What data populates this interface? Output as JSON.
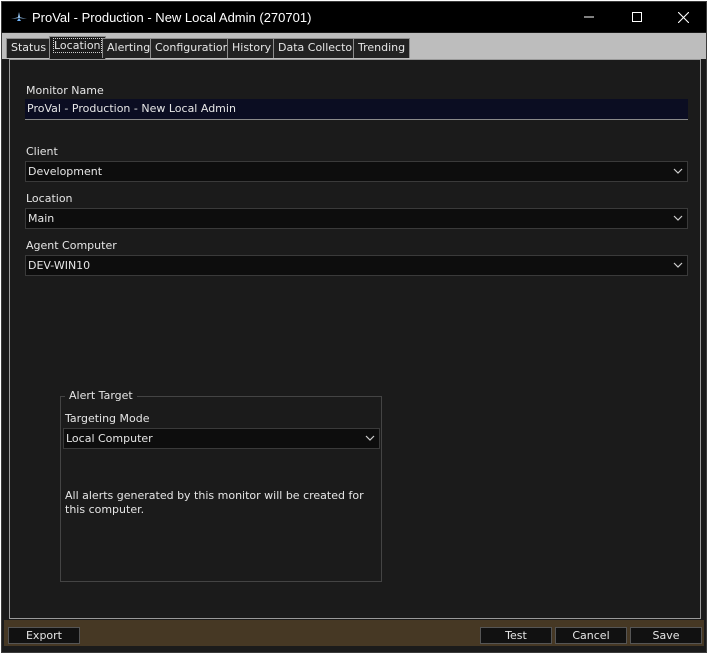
{
  "window": {
    "title": "ProVal - Production - New Local Admin (270701)"
  },
  "tabs": [
    "Status",
    "Location",
    "Alerting",
    "Configuration",
    "History",
    "Data Collector",
    "Trending"
  ],
  "active_tab": "Location",
  "form": {
    "monitor_name_label": "Monitor Name",
    "monitor_name_value": "ProVal - Production - New Local Admin",
    "client_label": "Client",
    "client_value": "Development",
    "location_label": "Location",
    "location_value": "Main",
    "agent_label": "Agent Computer",
    "agent_value": "DEV-WIN10"
  },
  "alert_target": {
    "title": "Alert Target",
    "mode_label": "Targeting Mode",
    "mode_value": "Local Computer",
    "note": "All alerts generated by this monitor will be created for this computer."
  },
  "buttons": {
    "export": "Export",
    "test": "Test",
    "cancel": "Cancel",
    "save": "Save"
  },
  "icons": [
    "app-icon",
    "minimize-icon",
    "maximize-icon",
    "close-icon",
    "chevron-down-icon"
  ]
}
